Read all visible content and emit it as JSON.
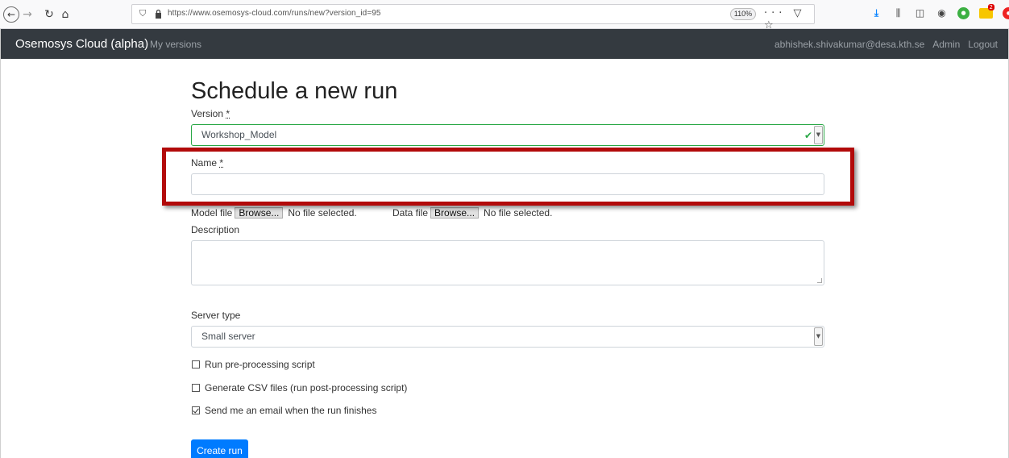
{
  "browser": {
    "url": "https://www.osemosys-cloud.com/runs/new?version_id=95",
    "zoom": "110%",
    "page_actions_icon": "···",
    "pocket_icon": "▽",
    "bookmark_icon": "☆",
    "folder_badge": "2"
  },
  "navbar": {
    "brand": "Osemosys Cloud (alpha)",
    "my_versions": "My versions",
    "user_email": "abhishek.shivakumar@desa.kth.se",
    "admin": "Admin",
    "logout": "Logout"
  },
  "form": {
    "title": "Schedule a new run",
    "version_label": "Version",
    "required_mark": "*",
    "version_value": "Workshop_Model",
    "name_label": "Name",
    "name_value": "",
    "model_file_label": "Model file",
    "data_file_label": "Data file",
    "browse_label": "Browse...",
    "no_file_text": "No file selected.",
    "description_label": "Description",
    "server_type_label": "Server type",
    "server_type_value": "Small server",
    "checkbox_preprocess": "Run pre-processing script",
    "checkbox_preprocess_checked": false,
    "checkbox_csv": "Generate CSV files (run post-processing script)",
    "checkbox_csv_checked": false,
    "checkbox_email": "Send me an email when the run finishes",
    "checkbox_email_checked": true,
    "submit_label": "Create run"
  },
  "colors": {
    "navbar_bg": "#343a40",
    "primary": "#007bff",
    "valid": "#28a745",
    "highlight": "#b20a0a"
  }
}
